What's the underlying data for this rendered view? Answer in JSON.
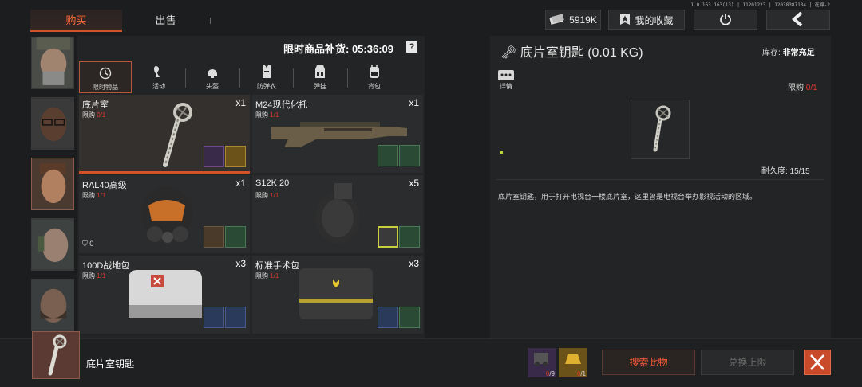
{
  "tabs": {
    "buy": "购买",
    "sell": "出售"
  },
  "version": "1.0.163.163(13) | 11201223 | 12038387134 | 在線-2",
  "currency": {
    "amount": "5919K"
  },
  "favorites_label": "我的收藏",
  "restock": "限时商品补货: 05:36:09",
  "help": "?",
  "categories": [
    {
      "label": "限时物品",
      "icon": "clock-icon"
    },
    {
      "label": "活动",
      "icon": "horn-icon"
    },
    {
      "label": "头盔",
      "icon": "helmet-icon"
    },
    {
      "label": "防弹衣",
      "icon": "vest-icon"
    },
    {
      "label": "弹挂",
      "icon": "rig-icon"
    },
    {
      "label": "背包",
      "icon": "backpack-icon"
    }
  ],
  "items": [
    {
      "name": "底片室",
      "limit_label": "限购",
      "limit": "0/1",
      "qty": "x1"
    },
    {
      "name": "M24现代化托",
      "limit_label": "限购",
      "limit": "1/1",
      "qty": "x1"
    },
    {
      "name": "RAL40高级",
      "limit_label": "限购",
      "limit": "1/1",
      "qty": "x1",
      "armor": "0"
    },
    {
      "name": "S12K 20",
      "limit_label": "限购",
      "limit": "1/1",
      "qty": "x5"
    },
    {
      "name": "100D战地包",
      "limit_label": "限购",
      "limit": "1/1",
      "qty": "x3"
    },
    {
      "name": "标准手术包",
      "limit_label": "限购",
      "limit": "1/1",
      "qty": "x3"
    }
  ],
  "detail": {
    "title": "底片室钥匙 (0.01 KG)",
    "stock_label": "库存:",
    "stock_value": "非常充足",
    "details_label": "详情",
    "limit_label": "限购",
    "limit": "0/1",
    "durability": "耐久度: 15/15",
    "description": "底片室钥匙，用于打开电视台一楼底片室，这里曾是电视台举办影视活动的区域。"
  },
  "bottom": {
    "selected_name": "底片室钥匙",
    "costs": [
      {
        "have": "0",
        "need": "/9"
      },
      {
        "have": "0",
        "need": "/1"
      }
    ],
    "search_label": "搜索此物",
    "redeem_label": "兑换上限"
  },
  "colors": {
    "accent": "#d2522a",
    "alert": "#d83a2a"
  }
}
